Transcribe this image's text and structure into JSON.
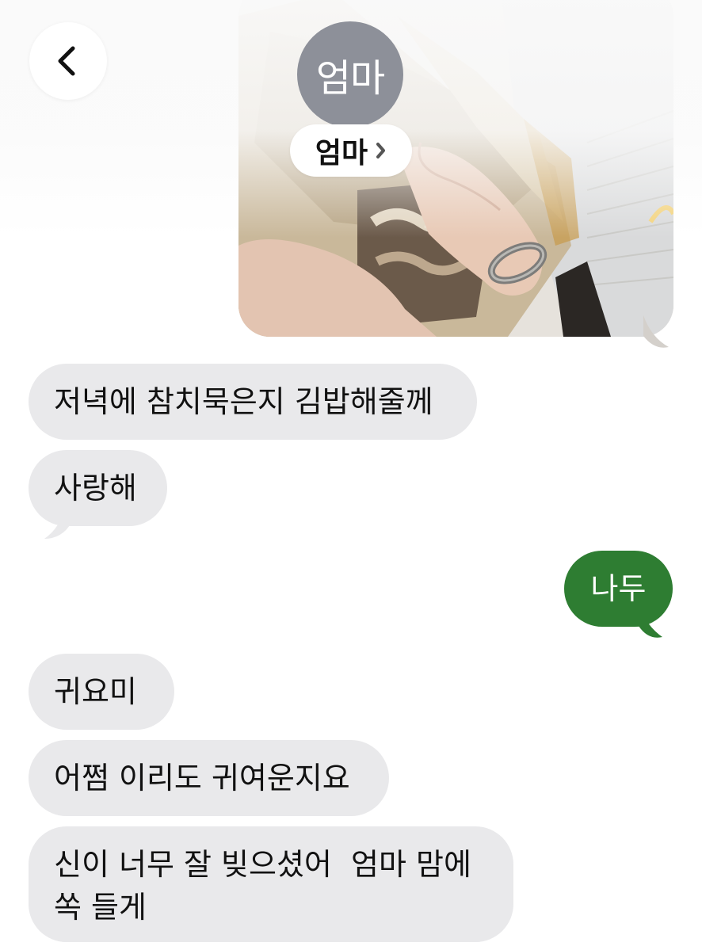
{
  "header": {
    "back_icon": "chevron-left-icon",
    "avatar_initials": "엄마",
    "contact_name": "엄마",
    "contact_chevron": "›"
  },
  "colors": {
    "incoming_bubble": "#e9e9eb",
    "outgoing_bubble": "#2e7d32",
    "avatar_bg": "#8d9099"
  },
  "messages": [
    {
      "direction": "outgoing",
      "type": "photo"
    },
    {
      "direction": "incoming",
      "text": "저녁에 참치묵은지 김밥해줄께"
    },
    {
      "direction": "incoming",
      "text": "사랑해"
    },
    {
      "direction": "outgoing",
      "text": "나두"
    },
    {
      "direction": "incoming",
      "text": "귀요미"
    },
    {
      "direction": "incoming",
      "text": "어쩜 이리도 귀여운지요"
    },
    {
      "direction": "incoming",
      "text_line1": "신이 너무 잘 빚으셨어  엄마 맘에",
      "text_line2": "쏙 들게"
    }
  ]
}
